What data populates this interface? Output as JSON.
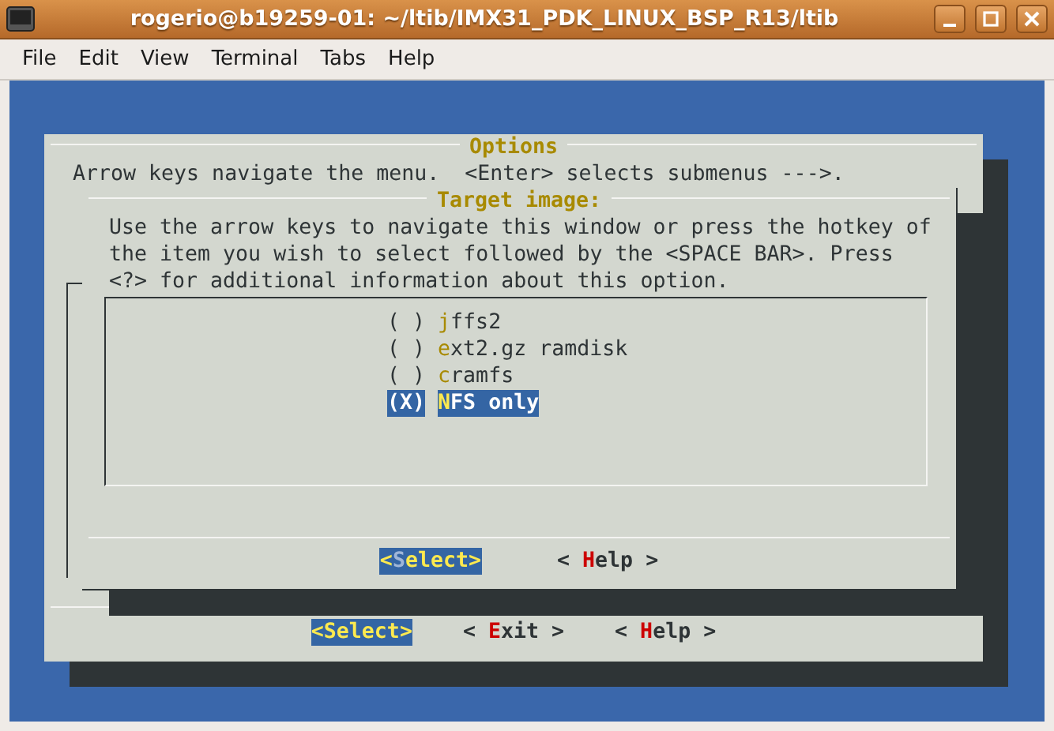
{
  "window": {
    "title": "rogerio@b19259-01: ~/ltib/IMX31_PDK_LINUX_BSP_R13/ltib"
  },
  "menu_bar": [
    {
      "label": "File"
    },
    {
      "label": "Edit"
    },
    {
      "label": "View"
    },
    {
      "label": "Terminal"
    },
    {
      "label": "Tabs"
    },
    {
      "label": "Help"
    }
  ],
  "options_dialog": {
    "title": "Options",
    "hint": "Arrow keys navigate the menu.  <Enter> selects submenus --->.",
    "buttons": [
      {
        "open": "<",
        "label": "Select",
        "close": ">",
        "selected": true
      },
      {
        "open": "< ",
        "label": "Exit",
        "close": " >",
        "selected": false
      },
      {
        "open": "< ",
        "label": "Help",
        "close": " >",
        "selected": false
      }
    ]
  },
  "target_dialog": {
    "title": "Target image:",
    "instructions": "Use the arrow keys to navigate this window or press the hotkey of\nthe item you wish to select followed by the <SPACE BAR>. Press\n<?> for additional information about this option.",
    "items": [
      {
        "marker": "( )",
        "label": "jffs2",
        "selected": false
      },
      {
        "marker": "( )",
        "label": "ext2.gz ramdisk",
        "selected": false
      },
      {
        "marker": "( )",
        "label": "cramfs",
        "selected": false
      },
      {
        "marker": "(X)",
        "label": "NFS only",
        "selected": true
      }
    ],
    "buttons": [
      {
        "open": "<",
        "label": "Select",
        "close": ">",
        "selected": true
      },
      {
        "open": "< ",
        "label": "Help",
        "close": " >",
        "selected": false
      }
    ]
  }
}
